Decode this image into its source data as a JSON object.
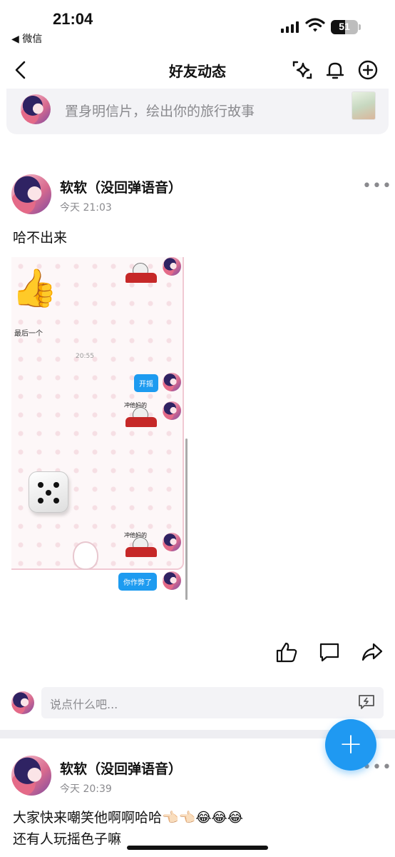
{
  "status": {
    "time": "21:04",
    "back_app": "◀ 微信",
    "battery": "51"
  },
  "nav": {
    "title": "好友动态"
  },
  "composer": {
    "placeholder": "置身明信片，绘出你的旅行故事"
  },
  "posts": [
    {
      "name": "软软（没回弹语音）",
      "time": "今天 21:03",
      "text": "哈不出来",
      "more": "•••",
      "screenshot": {
        "last_one": "最后一个",
        "timestamp": "20:55",
        "bubble1": "开摇",
        "meme_caption": "冲他妈的",
        "bubble2": "你作弊了"
      },
      "comment_placeholder": "说点什么吧..."
    },
    {
      "name": "软软（没回弹语音）",
      "time": "今天 20:39",
      "text_line1": "大家快来嘲笑他啊啊哈哈👈🏻👈🏻😂😂😂",
      "text_line2": "还有人玩摇色子嘛",
      "more": "•••"
    }
  ],
  "icons": [
    "chevron-left-icon",
    "sparkle-icon",
    "bell-icon",
    "plus-circle-icon",
    "like-icon",
    "comment-icon",
    "share-icon",
    "plus-icon"
  ]
}
